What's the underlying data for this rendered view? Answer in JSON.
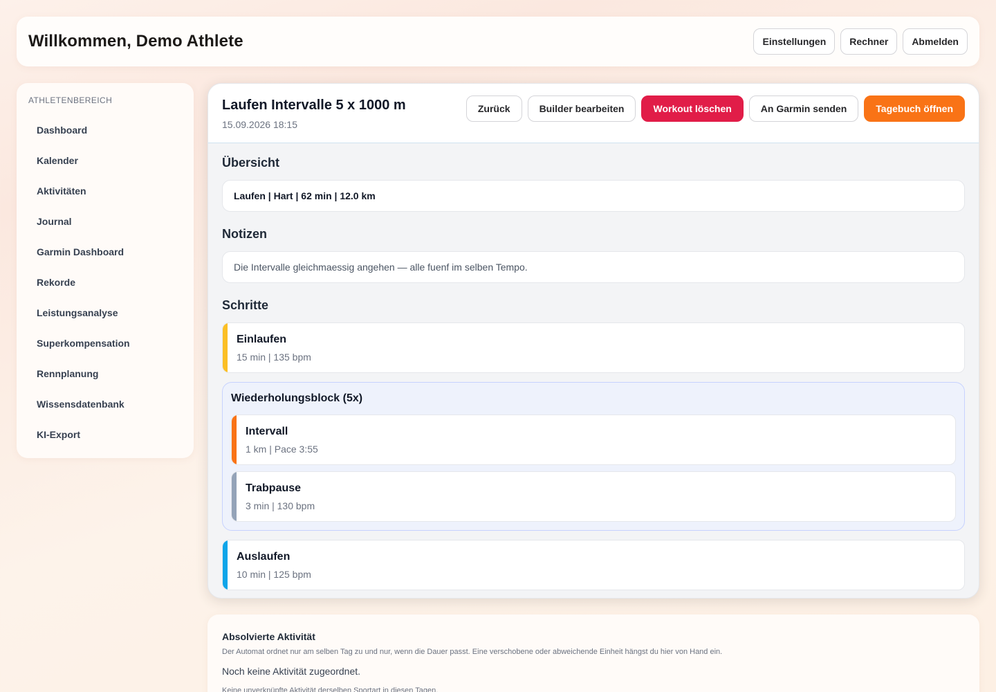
{
  "header": {
    "title": "Willkommen, Demo Athlete",
    "buttons": [
      "Einstellungen",
      "Rechner",
      "Abmelden"
    ]
  },
  "sidebar": {
    "section_label": "ATHLETENBEREICH",
    "items": [
      {
        "label": "Dashboard"
      },
      {
        "label": "Kalender"
      },
      {
        "label": "Aktivitäten"
      },
      {
        "label": "Journal"
      },
      {
        "label": "Garmin Dashboard"
      },
      {
        "label": "Rekorde"
      },
      {
        "label": "Leistungsanalyse"
      },
      {
        "label": "Superkompensation"
      },
      {
        "label": "Rennplanung"
      },
      {
        "label": "Wissensdatenbank"
      },
      {
        "label": "KI-Export"
      }
    ]
  },
  "workout": {
    "title": "Laufen Intervalle 5 x 1000 m",
    "date": "15.09.2026 18:15",
    "actions": {
      "back": "Zurück",
      "edit": "Builder bearbeiten",
      "delete": "Workout löschen",
      "garmin": "An Garmin senden",
      "journal": "Tagebuch öffnen"
    },
    "overview_title": "Übersicht",
    "overview": "Laufen | Hart | 62 min | 12.0 km",
    "notes_title": "Notizen",
    "notes": "Die Intervalle gleichmaessig angehen — alle fuenf im selben Tempo.",
    "steps_title": "Schritte",
    "warmup": {
      "name": "Einlaufen",
      "meta": "15 min | 135 bpm",
      "color": "#fbbf24"
    },
    "repeat": {
      "title": "Wiederholungsblock (5x)",
      "steps": [
        {
          "name": "Intervall",
          "meta": "1 km | Pace 3:55",
          "color": "#f97316"
        },
        {
          "name": "Trabpause",
          "meta": "3 min | 130 bpm",
          "color": "#94a3b8"
        }
      ]
    },
    "cooldown": {
      "name": "Auslaufen",
      "meta": "10 min | 125 bpm",
      "color": "#0ea5e9"
    }
  },
  "completed": {
    "title": "Absolvierte Aktivität",
    "description": "Der Automat ordnet nur am selben Tag zu und nur, wenn die Dauer passt. Eine verschobene oder abweichende Einheit hängst du hier von Hand ein.",
    "empty": "Noch keine Aktivität zugeordnet.",
    "hint": "Keine unverknüpfte Aktivität derselben Sportart in diesen Tagen."
  }
}
